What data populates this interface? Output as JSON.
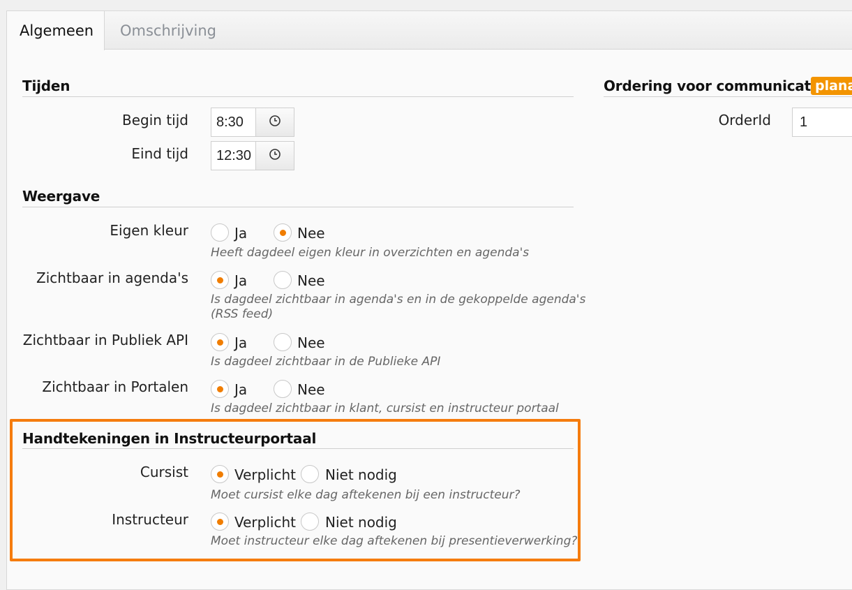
{
  "tabs": [
    {
      "label": "Algemeen",
      "active": true
    },
    {
      "label": "Omschrijving",
      "active": false
    }
  ],
  "tijden": {
    "title": "Tijden",
    "begin": {
      "label": "Begin tijd",
      "value": "8:30"
    },
    "eind": {
      "label": "Eind tijd",
      "value": "12:30"
    },
    "clock_icon": "clock-icon"
  },
  "weergave": {
    "title": "Weergave",
    "rows": [
      {
        "label": "Eigen kleur",
        "opt1": "Ja",
        "opt2": "Nee",
        "selected": "Nee",
        "hint": "Heeft dagdeel eigen kleur in overzichten en agenda's"
      },
      {
        "label": "Zichtbaar in agenda's",
        "opt1": "Ja",
        "opt2": "Nee",
        "selected": "Ja",
        "hint1": "Is dagdeel zichtbaar in agenda's en in de gekoppelde agenda's",
        "hint2": "(RSS feed)"
      },
      {
        "label": "Zichtbaar in Publiek API",
        "opt1": "Ja",
        "opt2": "Nee",
        "selected": "Ja",
        "hint": "Is dagdeel zichtbaar in de Publieke API"
      },
      {
        "label": "Zichtbaar in Portalen",
        "opt1": "Ja",
        "opt2": "Nee",
        "selected": "Ja",
        "hint": "Is dagdeel zichtbaar in klant, cursist en instructeur portaal"
      }
    ]
  },
  "handtekeningen": {
    "title": "Handtekeningen in Instructeurportaal",
    "rows": [
      {
        "label": "Cursist",
        "opt1": "Verplicht",
        "opt2": "Niet nodig",
        "selected": "Verplicht",
        "hint": "Moet cursist elke dag aftekenen bij een instructeur?"
      },
      {
        "label": "Instructeur",
        "opt1": "Verplicht",
        "opt2": "Niet nodig",
        "selected": "Verplicht",
        "hint": "Moet instructeur elke dag aftekenen bij presentieverwerking?"
      }
    ]
  },
  "ordering": {
    "title": "Ordering voor communicatie",
    "badge": "planac",
    "field_label": "OrderId",
    "field_value": "1"
  },
  "colors": {
    "accent": "#f07d00",
    "highlight_border": "#f57c0e",
    "badge": "#f39400"
  }
}
